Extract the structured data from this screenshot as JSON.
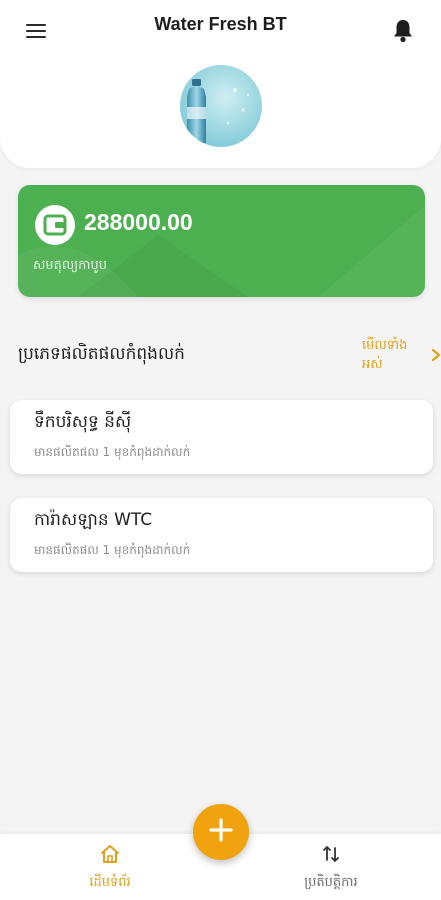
{
  "header": {
    "title": "Water Fresh BT",
    "menu_icon": "hamburger-menu-icon",
    "notification_icon": "bell-icon",
    "avatar_icon": "water-bottle-image"
  },
  "balance": {
    "amount": "288000.00",
    "label": "សមតុល្យកាបូប",
    "icon": "wallet-icon",
    "color": "#4caf50"
  },
  "section": {
    "title": "ប្រភេទផលិតផលកំពុងលក់",
    "see_all_label": "មើលទាំងអស់",
    "chevron_icon": "chevron-right-icon",
    "accent_color": "#e0a21a"
  },
  "products": [
    {
      "name": "ទឹកបរិសុទ្ធ នីស៊ី",
      "subtitle": "មានផលិតផល 1 មុខកំពុងដាក់លក់"
    },
    {
      "name": "ការ៉ាសឡាន WTC",
      "subtitle": "មានផលិតផល 1 មុខកំពុងដាក់លក់"
    }
  ],
  "bottom_nav": {
    "home_label": "ដើមទំព័រ",
    "home_icon": "home-icon",
    "transactions_label": "ប្រតិបត្តិការ",
    "transactions_icon": "swap-arrows-icon",
    "add_icon": "plus-icon",
    "active_color": "#e0a21a",
    "fab_color": "#f0a30e"
  }
}
